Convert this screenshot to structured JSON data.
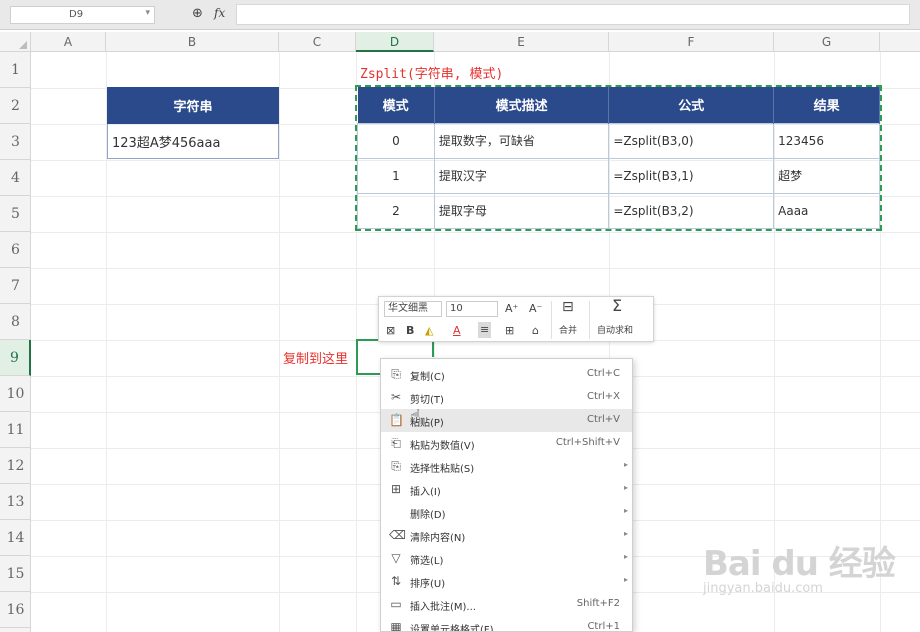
{
  "formula_bar": {
    "name_box": "D9",
    "zoom_icon": "zoom-icon",
    "fx_label": "fx",
    "formula": ""
  },
  "columns": [
    "A",
    "B",
    "C",
    "D",
    "E",
    "F",
    "G"
  ],
  "active_column": "D",
  "rows": [
    "1",
    "2",
    "3",
    "4",
    "5",
    "6",
    "7",
    "8",
    "9",
    "10",
    "11",
    "12",
    "13",
    "14",
    "15",
    "16"
  ],
  "active_row": "9",
  "title": "Zsplit(字符串, 模式)",
  "string_table": {
    "header": "字符串",
    "value": "123超A梦456aaa"
  },
  "mode_table": {
    "headers": [
      "模式",
      "模式描述",
      "公式",
      "结果"
    ],
    "rows": [
      {
        "mode": "0",
        "desc": "提取数字，可缺省",
        "formula": "=Zsplit(B3,0)",
        "result": "123456"
      },
      {
        "mode": "1",
        "desc": "提取汉字",
        "formula": "=Zsplit(B3,1)",
        "result": "超梦"
      },
      {
        "mode": "2",
        "desc": "提取字母",
        "formula": "=Zsplit(B3,2)",
        "result": "Aaaa"
      }
    ]
  },
  "annotation": "复制到这里",
  "mini_toolbar": {
    "font": "华文细黑",
    "size": "10",
    "grow": "A⁺",
    "shrink": "A⁻",
    "bold": "B",
    "merge": "合并",
    "autosum": "自动求和"
  },
  "context_menu": [
    {
      "label": "复制(C)",
      "shortcut": "Ctrl+C",
      "icon": "copy-icon",
      "glyph": "⎘"
    },
    {
      "label": "剪切(T)",
      "shortcut": "Ctrl+X",
      "icon": "cut-icon",
      "glyph": "✂"
    },
    {
      "label": "粘贴(P)",
      "shortcut": "Ctrl+V",
      "icon": "paste-icon",
      "glyph": "📋",
      "highlight": true
    },
    {
      "label": "粘贴为数值(V)",
      "shortcut": "Ctrl+Shift+V",
      "icon": "paste-values-icon",
      "glyph": "⎗"
    },
    {
      "label": "选择性粘贴(S)",
      "shortcut": "",
      "icon": "paste-special-icon",
      "glyph": "⎘",
      "submenu": true
    },
    {
      "label": "插入(I)",
      "shortcut": "",
      "icon": "insert-icon",
      "glyph": "⊞",
      "submenu": true
    },
    {
      "label": "删除(D)",
      "shortcut": "",
      "icon": "",
      "glyph": "",
      "submenu": true
    },
    {
      "label": "清除内容(N)",
      "shortcut": "",
      "icon": "clear-icon",
      "glyph": "⌫",
      "submenu": true
    },
    {
      "label": "筛选(L)",
      "shortcut": "",
      "icon": "filter-icon",
      "glyph": "▽",
      "submenu": true
    },
    {
      "label": "排序(U)",
      "shortcut": "",
      "icon": "sort-icon",
      "glyph": "⇅",
      "submenu": true
    },
    {
      "label": "插入批注(M)...",
      "shortcut": "Shift+F2",
      "icon": "comment-icon",
      "glyph": "▭"
    },
    {
      "label": "设置单元格格式(F)...",
      "shortcut": "Ctrl+1",
      "icon": "format-icon",
      "glyph": "▦"
    }
  ],
  "watermark": {
    "brand": "Bai du 经验",
    "url": "jingyan.baidu.com"
  }
}
